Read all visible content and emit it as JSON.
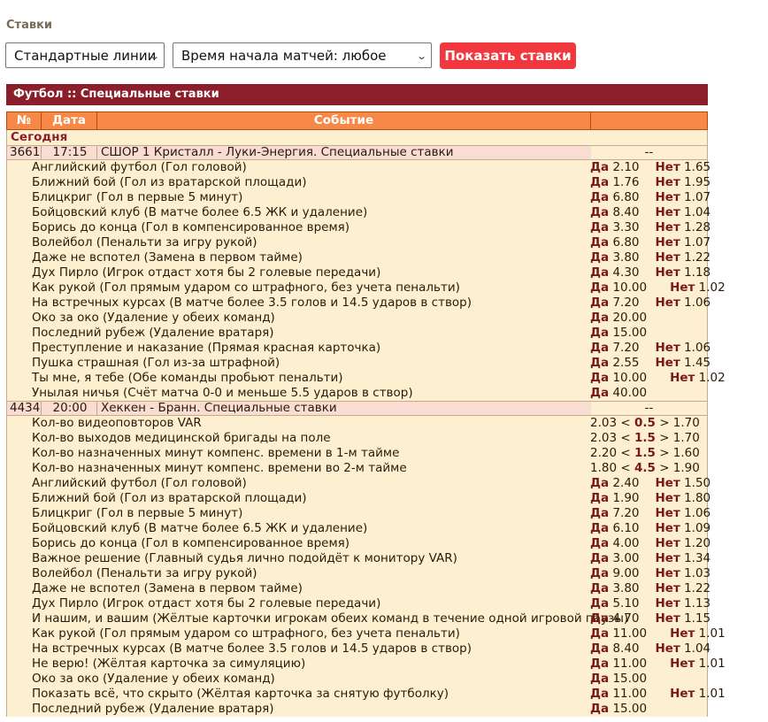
{
  "page_label": "Ставки",
  "filters": {
    "line_select": "Стандартные линии",
    "time_select": "Время начала матчей: любое",
    "show_button": "Показать ставки"
  },
  "header_title": "Футбол :: Специальные ставки",
  "columns": {
    "num": "№",
    "date": "Дата",
    "event": "Событие"
  },
  "section_today": "Сегодня",
  "events": [
    {
      "num": "3661",
      "time": "17:15",
      "title": "СШОР 1 Кристалл - Луки-Энергия. Специальные ставки",
      "dash": "--",
      "markets": [
        {
          "name": "Английский футбол (Гол головой)",
          "yes": "2.10",
          "no": "1.65"
        },
        {
          "name": "Ближний бой (Гол из вратарской площади)",
          "yes": "1.76",
          "no": "1.95"
        },
        {
          "name": "Блицкриг (Гол в первые 5 минут)",
          "yes": "6.80",
          "no": "1.07"
        },
        {
          "name": "Бойцовский клуб (В матче более 6.5 ЖК и удаление)",
          "yes": "8.40",
          "no": "1.04"
        },
        {
          "name": "Борись до конца (Гол в компенсированное время)",
          "yes": "3.30",
          "no": "1.28"
        },
        {
          "name": "Волейбол (Пенальти за игру рукой)",
          "yes": "6.80",
          "no": "1.07"
        },
        {
          "name": "Даже не вспотел (Замена в первом тайме)",
          "yes": "3.80",
          "no": "1.22"
        },
        {
          "name": "Дух Пирло (Игрок отдаст хотя бы 2 голевые передачи)",
          "yes": "4.30",
          "no": "1.18"
        },
        {
          "name": "Как рукой (Гол прямым ударом со штрафного, без учета пенальти)",
          "yes": "10.00",
          "no": "1.02"
        },
        {
          "name": "На встречных курсах (В матче более 3.5 голов и 14.5 ударов в створ)",
          "yes": "7.20",
          "no": "1.06"
        },
        {
          "name": "Око за око (Удаление у обеих команд)",
          "yes": "20.00",
          "no": ""
        },
        {
          "name": "Последний рубеж (Удаление вратаря)",
          "yes": "15.00",
          "no": ""
        },
        {
          "name": "Преступление и наказание (Прямая красная карточка)",
          "yes": "7.20",
          "no": "1.06"
        },
        {
          "name": "Пушка страшная (Гол из-за штрафной)",
          "yes": "2.55",
          "no": "1.45"
        },
        {
          "name": "Ты мне, я тебе (Обе команды пробьют пенальти)",
          "yes": "10.00",
          "no": "1.02"
        },
        {
          "name": "Унылая ничья (Счёт матча 0-0 и меньше 5.5 ударов в створ)",
          "yes": "40.00",
          "no": ""
        }
      ]
    },
    {
      "num": "4434",
      "time": "20:00",
      "title": "Хеккен - Бранн. Специальные ставки",
      "dash": "--",
      "totals": [
        {
          "name": "Кол-во видеоповторов VAR",
          "under": "2.03",
          "line": "0.5",
          "over": "1.70"
        },
        {
          "name": "Кол-во выходов медицинской бригады на поле",
          "under": "2.03",
          "line": "1.5",
          "over": "1.70"
        },
        {
          "name": "Кол-во назначенных минут компенс. времени в 1-м тайме",
          "under": "2.20",
          "line": "1.5",
          "over": "1.60"
        },
        {
          "name": "Кол-во назначенных минут компенс. времени во 2-м тайме",
          "under": "1.80",
          "line": "4.5",
          "over": "1.90"
        }
      ],
      "markets": [
        {
          "name": "Английский футбол (Гол головой)",
          "yes": "2.40",
          "no": "1.50"
        },
        {
          "name": "Ближний бой (Гол из вратарской площади)",
          "yes": "1.90",
          "no": "1.80"
        },
        {
          "name": "Блицкриг (Гол в первые 5 минут)",
          "yes": "7.20",
          "no": "1.06"
        },
        {
          "name": "Бойцовский клуб (В матче более 6.5 ЖК и удаление)",
          "yes": "6.10",
          "no": "1.09"
        },
        {
          "name": "Борись до конца (Гол в компенсированное время)",
          "yes": "4.00",
          "no": "1.20"
        },
        {
          "name": "Важное решение (Главный судья лично подойдёт к монитору VAR)",
          "yes": "3.00",
          "no": "1.34"
        },
        {
          "name": "Волейбол (Пенальти за игру рукой)",
          "yes": "9.00",
          "no": "1.03"
        },
        {
          "name": "Даже не вспотел (Замена в первом тайме)",
          "yes": "3.80",
          "no": "1.22"
        },
        {
          "name": "Дух Пирло (Игрок отдаст хотя бы 2 голевые передачи)",
          "yes": "5.10",
          "no": "1.13"
        },
        {
          "name": "И нашим, и вашим (Жёлтые карточки игрокам обеих команд в течение одной игровой паузы)",
          "yes": "4.70",
          "no": "1.15"
        },
        {
          "name": "Как рукой (Гол прямым ударом со штрафного, без учета пенальти)",
          "yes": "11.00",
          "no": "1.01"
        },
        {
          "name": "На встречных курсах (В матче более 3.5 голов и 14.5 ударов в створ)",
          "yes": "8.40",
          "no": "1.04"
        },
        {
          "name": "Не верю! (Жёлтая карточка за симуляцию)",
          "yes": "11.00",
          "no": "1.01"
        },
        {
          "name": "Око за око (Удаление у обеих команд)",
          "yes": "15.00",
          "no": ""
        },
        {
          "name": "Показать всё, что скрыто (Жёлтая карточка за снятую футболку)",
          "yes": "11.00",
          "no": "1.01"
        },
        {
          "name": "Последний рубеж (Удаление вратаря)",
          "yes": "15.00",
          "no": ""
        }
      ]
    }
  ],
  "labels": {
    "yes": "Да",
    "no": "Нет",
    "lt": "<",
    "gt": ">"
  }
}
